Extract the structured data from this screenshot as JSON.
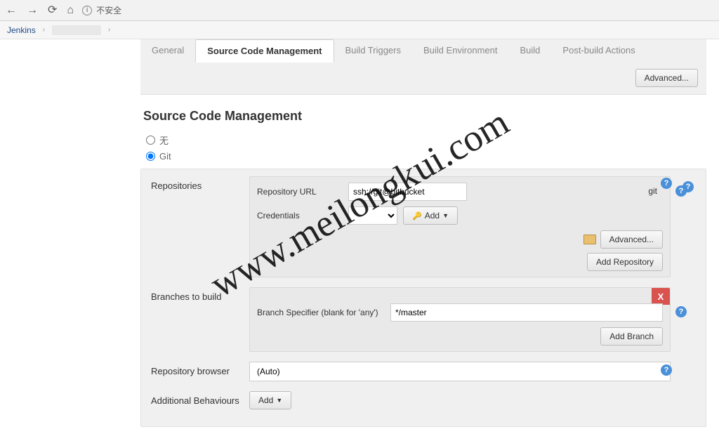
{
  "browser": {
    "security_label": "不安全"
  },
  "breadcrumb": {
    "root": "Jenkins"
  },
  "tabs": {
    "general": "General",
    "scm": "Source Code Management",
    "triggers": "Build Triggers",
    "env": "Build Environment",
    "build": "Build",
    "post": "Post-build Actions"
  },
  "buttons": {
    "advanced": "Advanced...",
    "add": "Add",
    "add_repo": "Add Repository",
    "add_branch": "Add Branch"
  },
  "section": {
    "title": "Source Code Management"
  },
  "scm_options": {
    "none": "无",
    "git": "Git"
  },
  "labels": {
    "repositories": "Repositories",
    "repo_url": "Repository URL",
    "credentials": "Credentials",
    "branches": "Branches to build",
    "branch_spec": "Branch Specifier (blank for 'any')",
    "repo_browser": "Repository browser",
    "additional": "Additional Behaviours"
  },
  "values": {
    "repo_url": "ssh://git@bitbucket",
    "repo_url_suffix": "git",
    "branch_spec": "*/master",
    "browser_auto": "(Auto)"
  },
  "watermark": "www.meilongkui.com"
}
